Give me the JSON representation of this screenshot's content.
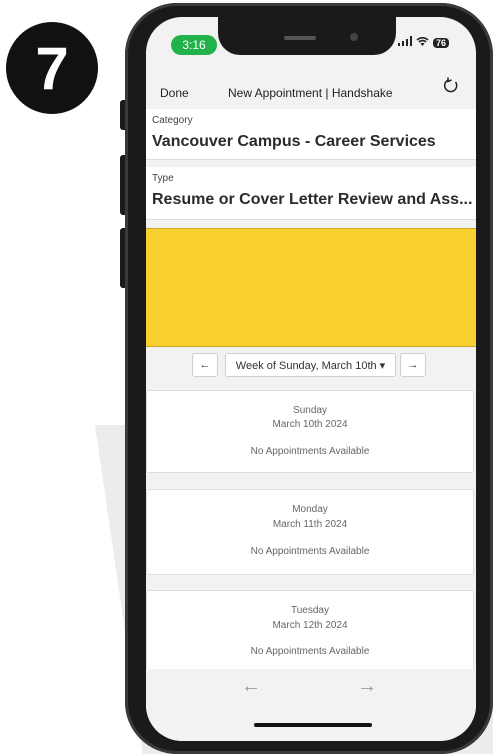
{
  "step": {
    "number": "7"
  },
  "status_bar": {
    "time": "3:16",
    "battery": "76"
  },
  "nav": {
    "done_label": "Done",
    "title": "New Appointment | Handshake"
  },
  "category": {
    "label": "Category",
    "value": "Vancouver Campus - Career Services"
  },
  "type": {
    "label": "Type",
    "value": "Resume or Cover Letter Review and Ass..."
  },
  "week": {
    "prev": "←",
    "label": "Week of Sunday, March 10th ▾",
    "next": "→"
  },
  "days": [
    {
      "name": "Sunday",
      "date": "March 10th 2024",
      "status": "No Appointments Available"
    },
    {
      "name": "Monday",
      "date": "March 11th 2024",
      "status": "No Appointments Available"
    },
    {
      "name": "Tuesday",
      "date": "March 12th 2024",
      "status": "No Appointments Available"
    }
  ],
  "footer": {
    "back": "←",
    "forward": "→"
  },
  "colors": {
    "time_pill": "#22b24c",
    "redaction": "#f8d030"
  },
  "icons": {
    "refresh": "refresh-icon",
    "wifi": "wifi-icon",
    "signal": "signal-icon"
  }
}
